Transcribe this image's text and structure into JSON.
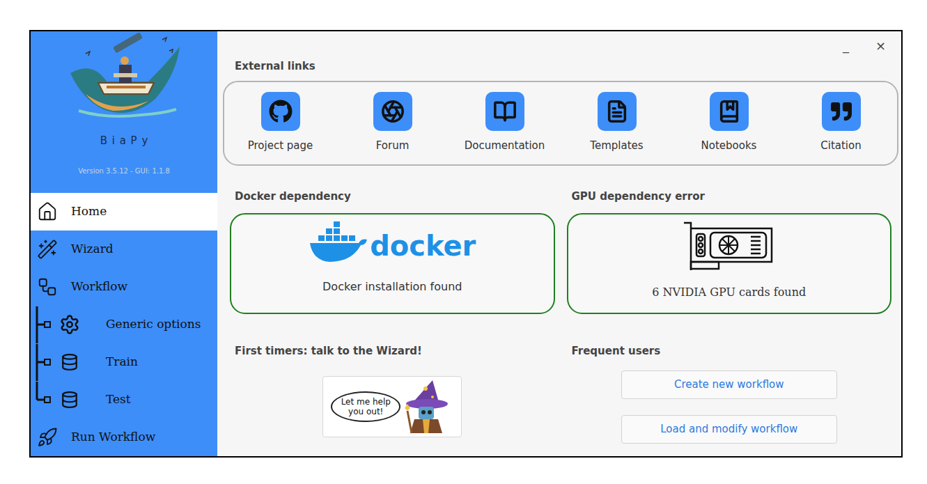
{
  "window": {
    "controls": [
      "_",
      "×"
    ]
  },
  "sidebar": {
    "app_name": "BiaPy",
    "version": "Version 3.5.12 - GUI: 1.1.8",
    "items": [
      {
        "label": "Home",
        "selected": true,
        "kind": "top"
      },
      {
        "label": "Wizard",
        "selected": false,
        "kind": "top"
      },
      {
        "label": "Workflow",
        "selected": false,
        "kind": "top"
      },
      {
        "label": "Generic options",
        "selected": false,
        "kind": "branch"
      },
      {
        "label": "Train",
        "selected": false,
        "kind": "branch"
      },
      {
        "label": "Test",
        "selected": false,
        "kind": "branch-end"
      },
      {
        "label": "Run Workflow",
        "selected": false,
        "kind": "top"
      }
    ]
  },
  "external_links": {
    "title": "External links",
    "items": [
      "Project page",
      "Forum",
      "Documentation",
      "Templates",
      "Notebooks",
      "Citation"
    ]
  },
  "docker": {
    "title": "Docker dependency",
    "logo_text": "docker",
    "status": "Docker installation found",
    "ok": true
  },
  "gpu": {
    "title": "GPU dependency error",
    "status": "6 NVIDIA GPU cards found",
    "ok": true
  },
  "wizard": {
    "title": "First timers: talk to the Wizard!",
    "bubble": "Let me help you out!"
  },
  "frequent": {
    "title": "Frequent users",
    "buttons": [
      "Create new workflow",
      "Load and modify workflow"
    ]
  }
}
